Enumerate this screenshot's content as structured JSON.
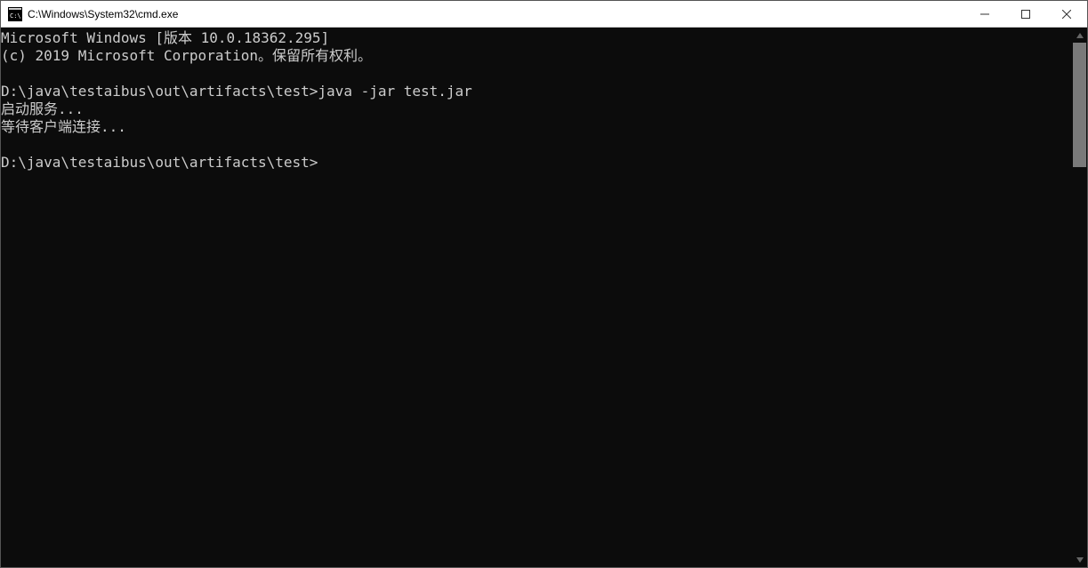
{
  "titlebar": {
    "title": "C:\\Windows\\System32\\cmd.exe"
  },
  "terminal": {
    "lines": [
      "Microsoft Windows [版本 10.0.18362.295]",
      "(c) 2019 Microsoft Corporation。保留所有权利。",
      "",
      "D:\\java\\testaibus\\out\\artifacts\\test>java -jar test.jar",
      "启动服务...",
      "等待客户端连接...",
      "",
      "D:\\java\\testaibus\\out\\artifacts\\test>"
    ]
  }
}
